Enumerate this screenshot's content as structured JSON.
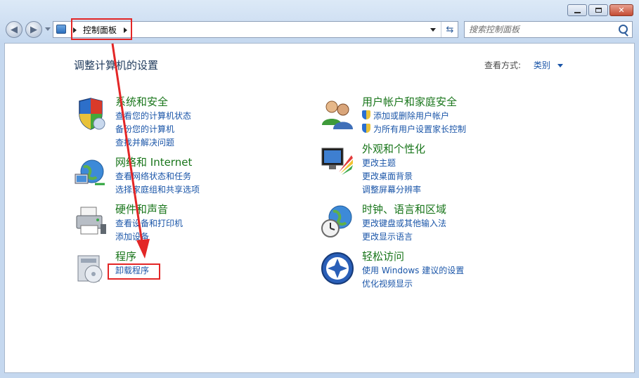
{
  "window": {
    "breadcrumb": "控制面板",
    "search_placeholder": "搜索控制面板"
  },
  "main": {
    "heading": "调整计算机的设置",
    "view_by_label": "查看方式:",
    "view_by_value": "类别"
  },
  "categories_left": [
    {
      "title": "系统和安全",
      "icon": "shield-icon",
      "links": [
        "查看您的计算机状态",
        "备份您的计算机",
        "查找并解决问题"
      ]
    },
    {
      "title": "网络和 Internet",
      "icon": "network-globe-icon",
      "links": [
        "查看网络状态和任务",
        "选择家庭组和共享选项"
      ]
    },
    {
      "title": "硬件和声音",
      "icon": "printer-icon",
      "links": [
        "查看设备和打印机",
        "添加设备"
      ]
    },
    {
      "title": "程序",
      "icon": "programs-icon",
      "links": [
        "卸载程序"
      ]
    }
  ],
  "categories_right": [
    {
      "title": "用户帐户和家庭安全",
      "icon": "users-icon",
      "links": [
        "添加或删除用户帐户",
        "为所有用户设置家长控制"
      ]
    },
    {
      "title": "外观和个性化",
      "icon": "monitor-palette-icon",
      "links": [
        "更改主题",
        "更改桌面背景",
        "调整屏幕分辨率"
      ]
    },
    {
      "title": "时钟、语言和区域",
      "icon": "clock-globe-icon",
      "links": [
        "更改键盘或其他输入法",
        "更改显示语言"
      ]
    },
    {
      "title": "轻松访问",
      "icon": "ease-of-access-icon",
      "links": [
        "使用 Windows 建议的设置",
        "优化视频显示"
      ]
    }
  ],
  "colors": {
    "annotation": "#e32626",
    "link": "#1a55a8",
    "category_title": "#18751a"
  }
}
